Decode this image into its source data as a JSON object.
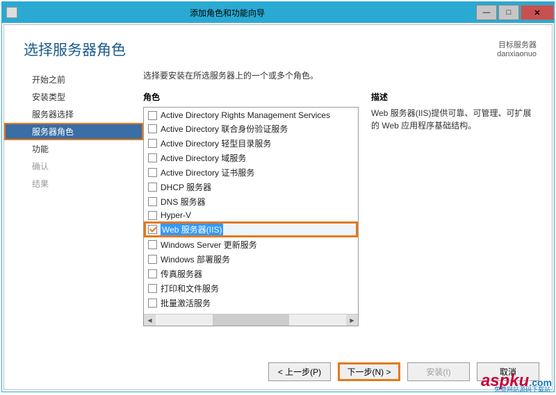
{
  "window": {
    "title": "添加角色和功能向导"
  },
  "header": {
    "page_title": "选择服务器角色",
    "target_label": "目标服务器",
    "target_server": "danxiaonuo"
  },
  "sidebar": {
    "items": [
      {
        "label": "开始之前",
        "state": "normal"
      },
      {
        "label": "安装类型",
        "state": "normal"
      },
      {
        "label": "服务器选择",
        "state": "normal"
      },
      {
        "label": "服务器角色",
        "state": "active"
      },
      {
        "label": "功能",
        "state": "normal"
      },
      {
        "label": "确认",
        "state": "disabled"
      },
      {
        "label": "结果",
        "state": "disabled"
      }
    ]
  },
  "main": {
    "instruction": "选择要安装在所选服务器上的一个或多个角色。",
    "roles_label": "角色",
    "desc_label": "描述",
    "description_text": "Web 服务器(IIS)提供可靠、可管理、可扩展的 Web 应用程序基础结构。",
    "roles": [
      {
        "label": "Active Directory Rights Management Services",
        "checked": false
      },
      {
        "label": "Active Directory 联合身份验证服务",
        "checked": false
      },
      {
        "label": "Active Directory 轻型目录服务",
        "checked": false
      },
      {
        "label": "Active Directory 域服务",
        "checked": false
      },
      {
        "label": "Active Directory 证书服务",
        "checked": false
      },
      {
        "label": "DHCP 服务器",
        "checked": false
      },
      {
        "label": "DNS 服务器",
        "checked": false
      },
      {
        "label": "Hyper-V",
        "checked": false
      },
      {
        "label": "Web 服务器(IIS)",
        "checked": true,
        "highlighted": true
      },
      {
        "label": "Windows Server 更新服务",
        "checked": false
      },
      {
        "label": "Windows 部署服务",
        "checked": false
      },
      {
        "label": "传真服务器",
        "checked": false
      },
      {
        "label": "打印和文件服务",
        "checked": false
      },
      {
        "label": "批量激活服务",
        "checked": false
      }
    ]
  },
  "footer": {
    "previous": "< 上一步(P)",
    "next": "下一步(N) >",
    "install": "安装(I)",
    "cancel": "取消"
  },
  "watermark": {
    "brand": "aspku",
    "suffix": ".com",
    "sub": "免费网站源码下载站"
  }
}
